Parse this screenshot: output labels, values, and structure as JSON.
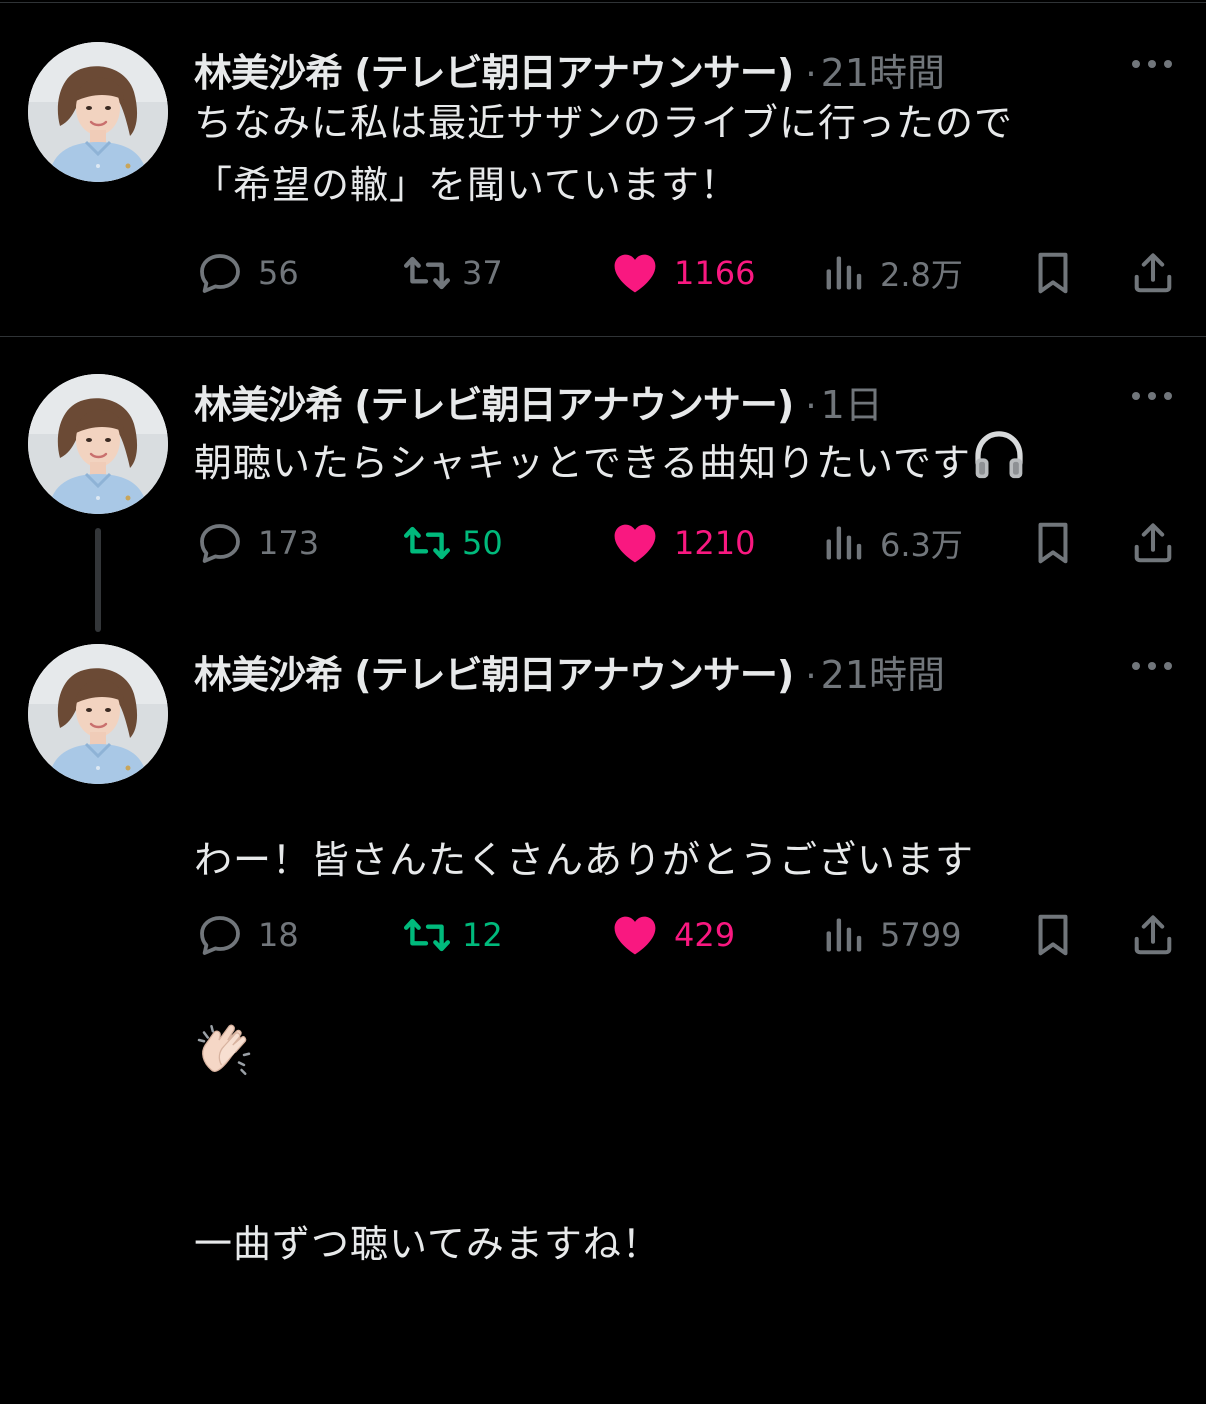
{
  "tweets": [
    {
      "name": "林美沙希 (テレビ朝日アナウンサー)",
      "dot": "·",
      "time": "21時間",
      "text": "ちなみに私は最近サザンのライブに行ったので\n「希望の轍」を聞いています！",
      "replies": "56",
      "retweets": "37",
      "likes": "1166",
      "views": "2.8万",
      "retweeted": false
    },
    {
      "name": "林美沙希 (テレビ朝日アナウンサー)",
      "dot": "·",
      "time": "1日",
      "text": "朝聴いたらシャキッとできる曲知りたいです",
      "emoji": "headphones",
      "replies": "173",
      "retweets": "50",
      "likes": "1210",
      "views": "6.3万",
      "retweeted": true
    },
    {
      "name": "林美沙希 (テレビ朝日アナウンサー)",
      "dot": "·",
      "time": "21時間",
      "text_line1": "わー！皆さんたくさんありがとうございます",
      "emoji": "clapping-hands",
      "text_line3": "一曲ずつ聴いてみますね！",
      "replies": "18",
      "retweets": "12",
      "likes": "429",
      "views": "5799",
      "retweeted": true
    }
  ],
  "colors": {
    "background": "#000000",
    "text": "#e7e9ea",
    "muted": "#71767b",
    "like": "#f91880",
    "retweet": "#00ba7c"
  },
  "icons": [
    "reply-icon",
    "retweet-icon",
    "like-icon",
    "views-icon",
    "bookmark-icon",
    "share-icon",
    "more-icon"
  ]
}
